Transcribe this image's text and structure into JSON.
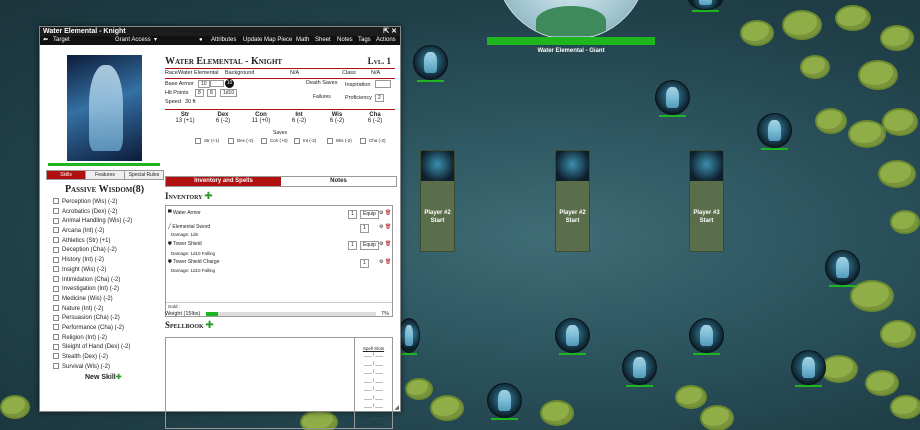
{
  "window": {
    "title": "Water Elemental - Knight"
  },
  "toolbar": {
    "target": "Target",
    "grant_access": "Grant Access",
    "attributes": "Attributes",
    "update_map_piece": "Update Map Piece",
    "math": "Math",
    "sheet": "Sheet",
    "notes": "Notes",
    "tags": "Tags",
    "actions": "Actions"
  },
  "character": {
    "name": "Water Elemental - Knight",
    "level": "Lvl. 1",
    "race_label": "Race",
    "race": "Water Elemental",
    "background_label": "Background",
    "background": "N/A",
    "class_label": "Class",
    "class": "N/A",
    "base_armor_label": "Base Armor",
    "base_armor": "10",
    "ac": "10",
    "hit_points_label": "Hit Points",
    "hp_current": "8",
    "hp_max": "8",
    "hit_dice": "1d10",
    "speed_label": "Speed",
    "speed": "30 ft",
    "death_saves_label": "Death Saves",
    "failures_label": "Failures",
    "inspiration_label": "Inspiration",
    "proficiency_label": "Proficiency",
    "proficiency": "2"
  },
  "abilities": [
    {
      "name": "Str",
      "score": "13",
      "mod": "(+1)",
      "save": "Str (+1)"
    },
    {
      "name": "Dex",
      "score": "6",
      "mod": "(-2)",
      "save": "Dex (-2)"
    },
    {
      "name": "Con",
      "score": "11",
      "mod": "(+0)",
      "save": "Con (+0)"
    },
    {
      "name": "Int",
      "score": "6",
      "mod": "(-2)",
      "save": "Int (-2)"
    },
    {
      "name": "Wis",
      "score": "6",
      "mod": "(-2)",
      "save": "Wis (-2)"
    },
    {
      "name": "Cha",
      "score": "6",
      "mod": "(-2)",
      "save": "Cha (-2)"
    }
  ],
  "saves_label": "Saves",
  "left_tabs": [
    "Skills",
    "Features",
    "Special Rules"
  ],
  "passive_wisdom": "Passive Wisdom(8)",
  "skills": [
    "Perception (Wis) (-2)",
    "Acrobatics (Dex) (-2)",
    "Animal Handling (Wis) (-2)",
    "Arcana (Int) (-2)",
    "Athletics (Str) (+1)",
    "Deception (Cha) (-2)",
    "History (Int) (-2)",
    "Insight (Wis) (-2)",
    "Intimidation (Cha) (-2)",
    "Investigation (Int) (-2)",
    "Medicine (Wis) (-2)",
    "Nature (Int) (-2)",
    "Persuasion (Cha) (-2)",
    "Performance (Cha) (-2)",
    "Religion (Int) (-2)",
    "Sleight of Hand (Dex) (-2)",
    "Stealth (Dex) (-2)",
    "Survival (Wis) (-2)"
  ],
  "new_skill": "New Skill",
  "main_tabs": [
    "Inventory and Spells",
    "Notes"
  ],
  "inventory": {
    "title": "Inventory",
    "items": [
      {
        "name": "Water Armor",
        "qty": "1",
        "equip": "Equip",
        "damage": ""
      },
      {
        "name": "Elemental Sword",
        "qty": "1",
        "equip": "",
        "damage": "Damage: 1d6"
      },
      {
        "name": "Tower Shield",
        "qty": "1",
        "equip": "Equip",
        "damage": "Damage: 1d10 Falling"
      },
      {
        "name": "Tower Shield Charge",
        "qty": "1",
        "equip": "",
        "damage": "Damage: 1d10 Falling"
      }
    ],
    "gold_label": "Gold :",
    "weight_label": "Weight (15lbs)",
    "weight_pct": "7%",
    "weight_fraction": 0.07
  },
  "spellbook": {
    "title": "Spellbook",
    "slots_label": "Spell Slots",
    "slot_rows": [
      "___ / ___",
      "___ / ___",
      "___ / ___",
      "___ / ___",
      "___ / ___",
      "___ / ___",
      "___ / ___",
      "___ / ___",
      "___ / ___"
    ]
  },
  "map": {
    "giant_label": "Water Elemental - Giant",
    "tiles": [
      {
        "line1": "Player #2",
        "line2": "Start"
      },
      {
        "line1": "Player #2",
        "line2": "Start"
      },
      {
        "line1": "Player #3",
        "line2": "Start"
      }
    ]
  },
  "colors": {
    "accent_red": "#b01010",
    "hp_green": "#1fb51f",
    "add_green": "#2e9a2e"
  }
}
